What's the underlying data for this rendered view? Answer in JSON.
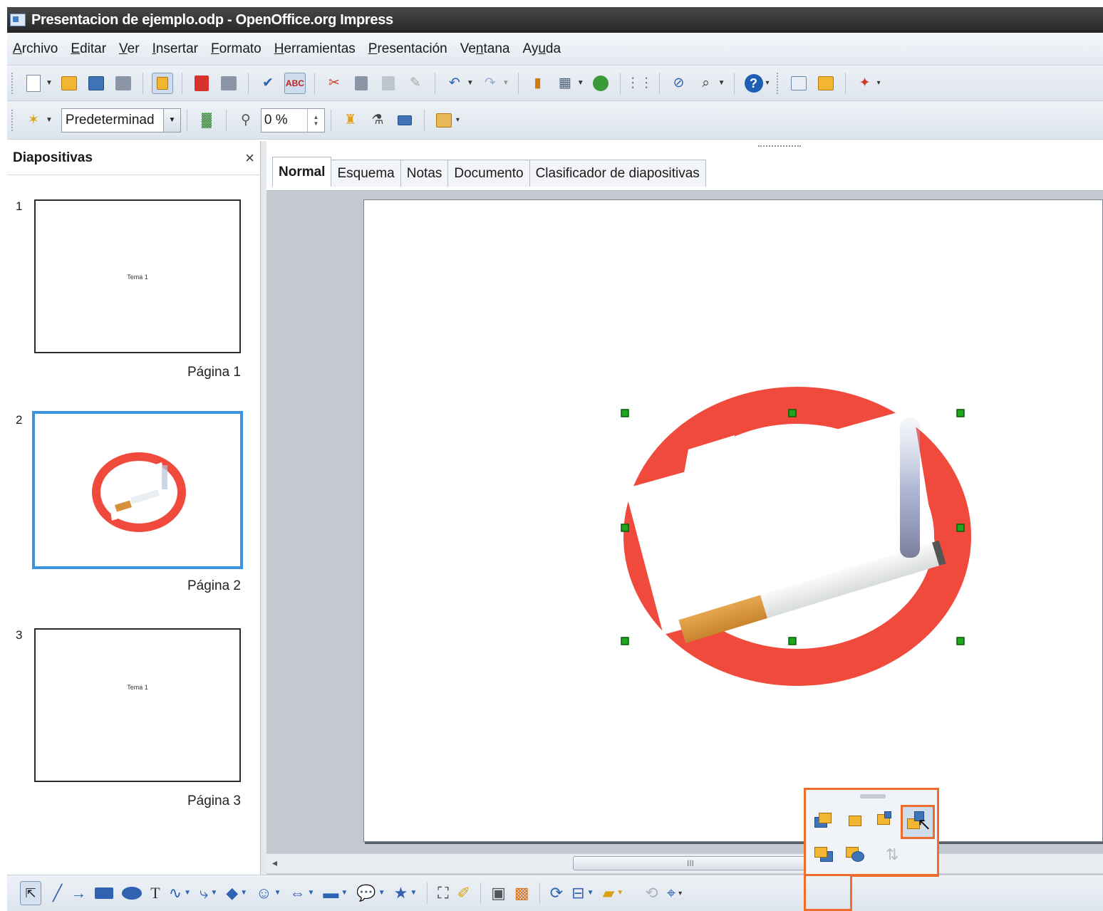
{
  "window": {
    "title": "Presentacion de ejemplo.odp - OpenOffice.org Impress"
  },
  "menu": [
    {
      "pre": "",
      "u": "A",
      "post": "rchivo"
    },
    {
      "pre": "",
      "u": "E",
      "post": "ditar"
    },
    {
      "pre": "",
      "u": "V",
      "post": "er"
    },
    {
      "pre": "",
      "u": "I",
      "post": "nsertar"
    },
    {
      "pre": "",
      "u": "F",
      "post": "ormato"
    },
    {
      "pre": "",
      "u": "H",
      "post": "erramientas"
    },
    {
      "pre": "",
      "u": "P",
      "post": "resentación"
    },
    {
      "pre": "Ve",
      "u": "n",
      "post": "tana"
    },
    {
      "pre": "Ay",
      "u": "u",
      "post": "da"
    }
  ],
  "toolbar2": {
    "style_value": "Predeterminad",
    "transparency_value": "0 %"
  },
  "slides_panel": {
    "title": "Diapositivas",
    "close": "×",
    "slides": [
      {
        "number": "1",
        "caption": "Página 1",
        "thumb_text": "Tema 1"
      },
      {
        "number": "2",
        "caption": "Página 2",
        "thumb_text": ""
      },
      {
        "number": "3",
        "caption": "Página 3",
        "thumb_text": "Tema 1"
      }
    ]
  },
  "view_tabs": [
    "Normal",
    "Esquema",
    "Notas",
    "Documento",
    "Clasificador de diapositivas"
  ],
  "active_tab": "Normal",
  "scrollbar": {
    "thumb_label": "III"
  },
  "colors": {
    "accent_highlight": "#ee6c2c",
    "selection_blue": "#3a95e0",
    "no_smoking_red": "#f04a3c",
    "handle_green": "#1fa51f"
  },
  "icons": {
    "toolbar1": [
      "new-document-icon",
      "open-folder-icon",
      "save-icon",
      "email-icon",
      "edit-mode-icon",
      "export-pdf-icon",
      "print-icon",
      "spellcheck-icon",
      "autospellcheck-icon",
      "cut-icon",
      "copy-icon",
      "paste-icon",
      "clone-format-icon",
      "undo-icon",
      "redo-icon",
      "chart-icon",
      "table-icon",
      "display-grid-icon",
      "grid-icon",
      "navigator-icon",
      "zoom-icon",
      "help-icon",
      "slide-show-icon",
      "new-slide-icon",
      "presentation-icon"
    ],
    "draw": [
      "select-icon",
      "line-icon",
      "arrow-icon",
      "rectangle-icon",
      "ellipse-icon",
      "text-icon",
      "curve-icon",
      "connector-icon",
      "basic-shapes-icon",
      "symbol-shapes-icon",
      "block-arrows-icon",
      "flowchart-icon",
      "callouts-icon",
      "stars-icon",
      "points-icon",
      "fontwork-icon",
      "from-file-icon",
      "gallery-icon",
      "rotate-icon",
      "alignment-icon",
      "arrange-icon",
      "extrusion-icon",
      "3d-icon"
    ],
    "arrange_popup": [
      "bring-to-front-icon",
      "bring-forward-icon",
      "send-backward-icon",
      "send-to-back-icon",
      "in-front-of-object-icon",
      "behind-object-icon",
      "reverse-icon"
    ]
  }
}
